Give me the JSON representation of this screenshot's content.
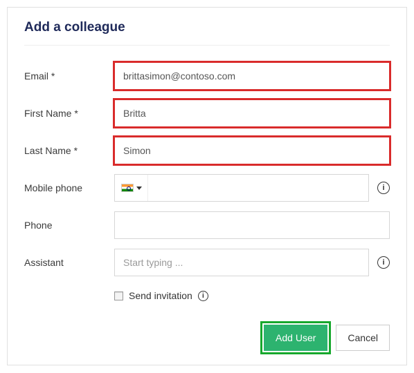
{
  "title": "Add a colleague",
  "labels": {
    "email": "Email *",
    "firstName": "First Name *",
    "lastName": "Last Name *",
    "mobile": "Mobile phone",
    "phone": "Phone",
    "assistant": "Assistant",
    "sendInvitation": "Send invitation"
  },
  "values": {
    "email": "brittasimon@contoso.com",
    "firstName": "Britta",
    "lastName": "Simon",
    "mobile": "",
    "phone": "",
    "assistant": ""
  },
  "placeholders": {
    "assistant": "Start typing ..."
  },
  "country": {
    "name": "India"
  },
  "checkbox": {
    "sendInvitation": false
  },
  "buttons": {
    "addUser": "Add User",
    "cancel": "Cancel"
  },
  "infoGlyph": "i"
}
